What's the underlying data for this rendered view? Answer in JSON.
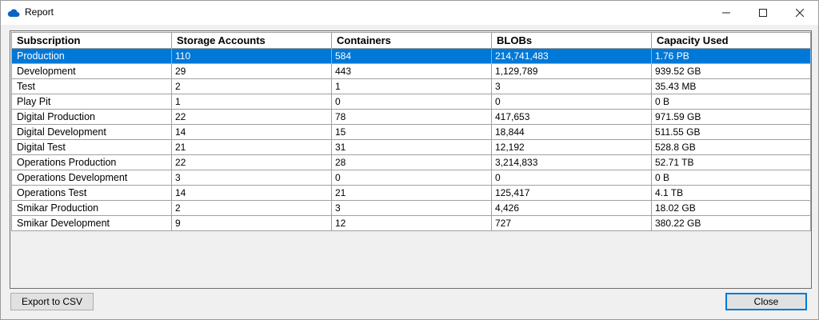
{
  "window": {
    "title": "Report",
    "icon": "cloud-icon",
    "accent": "#0078d7"
  },
  "grid": {
    "columns": [
      "Subscription",
      "Storage Accounts",
      "Containers",
      "BLOBs",
      "Capacity Used"
    ],
    "selected_row": 0,
    "rows": [
      [
        "Production",
        "110",
        "584",
        "214,741,483",
        "1.76 PB"
      ],
      [
        "Development",
        "29",
        "443",
        "1,129,789",
        "939.52 GB"
      ],
      [
        "Test",
        "2",
        "1",
        "3",
        "35.43 MB"
      ],
      [
        "Play Pit",
        "1",
        "0",
        "0",
        "0 B"
      ],
      [
        "Digital Production",
        "22",
        "78",
        "417,653",
        "971.59 GB"
      ],
      [
        "Digital Development",
        "14",
        "15",
        "18,844",
        "511.55 GB"
      ],
      [
        "Digital Test",
        "21",
        "31",
        "12,192",
        "528.8 GB"
      ],
      [
        "Operations Production",
        "22",
        "28",
        "3,214,833",
        "52.71 TB"
      ],
      [
        "Operations Development",
        "3",
        "0",
        "0",
        "0 B"
      ],
      [
        "Operations Test",
        "14",
        "21",
        "125,417",
        "4.1 TB"
      ],
      [
        "Smikar Production",
        "2",
        "3",
        "4,426",
        "18.02 GB"
      ],
      [
        "Smikar Development",
        "9",
        "12",
        "727",
        "380.22 GB"
      ]
    ]
  },
  "buttons": {
    "export": "Export to CSV",
    "close": "Close"
  }
}
